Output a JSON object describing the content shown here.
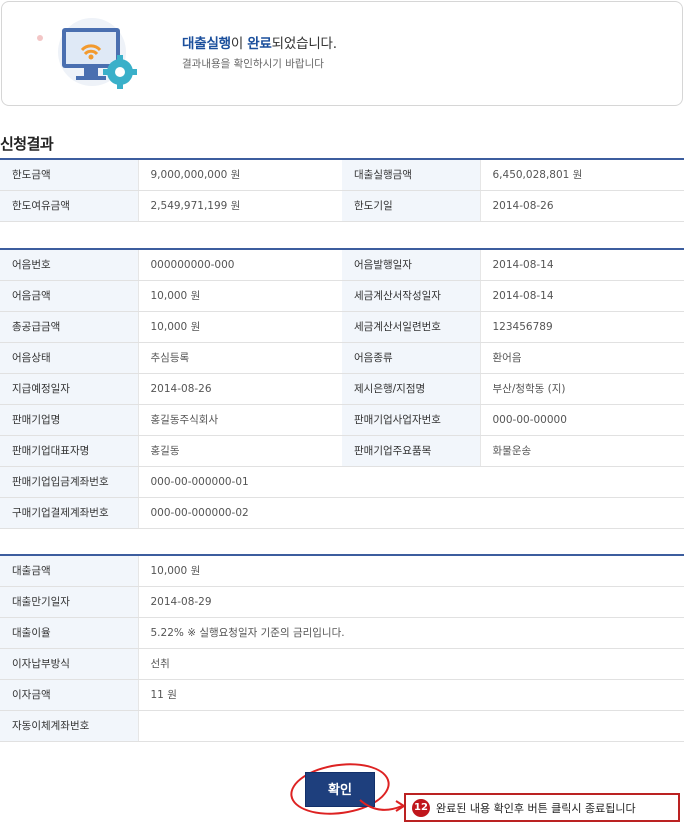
{
  "notice": {
    "msg_part1": "대출실행",
    "msg_part2": "이 ",
    "msg_part3": "완료",
    "msg_part4": "되었습니다.",
    "sub": "결과내용을 확인하시기 바랍니다"
  },
  "section_title": "신청결과",
  "summary": [
    [
      "한도금액",
      "9,000,000,000 원",
      "대출실행금액",
      "6,450,028,801 원"
    ],
    [
      "한도여유금액",
      "2,549,971,199 원",
      "한도기일",
      "2014-08-26"
    ]
  ],
  "bill": [
    [
      "어음번호",
      "000000000-000",
      "어음발행일자",
      "2014-08-14"
    ],
    [
      "어음금액",
      "10,000 원",
      "세금계산서작성일자",
      "2014-08-14"
    ],
    [
      "총공급금액",
      "10,000 원",
      "세금계산서일련번호",
      "123456789"
    ],
    [
      "어음상태",
      "추심등록",
      "어음종류",
      "환어음"
    ],
    [
      "지급예정일자",
      "2014-08-26",
      "제시은행/지점명",
      "부산/청학동 (지)"
    ],
    [
      "판매기업명",
      "홍길동주식회사",
      "판매기업사업자번호",
      "000-00-00000"
    ],
    [
      "판매기업대표자명",
      "홍길동",
      "판매기업주요품목",
      "화물운송"
    ]
  ],
  "bill_wide": [
    [
      "판매기업입금계좌번호",
      "000-00-000000-01"
    ],
    [
      "구매기업결제계좌번호",
      "000-00-000000-02"
    ]
  ],
  "loan": [
    [
      "대출금액",
      "10,000 원"
    ],
    [
      "대출만기일자",
      "2014-08-29"
    ],
    [
      "대출이율",
      "5.22% ※ 실행요청일자 기준의 금리입니다."
    ],
    [
      "이자납부방식",
      "선취"
    ],
    [
      "이자금액",
      "11 원"
    ],
    [
      "자동이체계좌번호",
      ""
    ]
  ],
  "confirm_button": "확인",
  "callout": {
    "step": "12",
    "text": "완료된 내용 확인후 버튼 클릭시 종료됩니다"
  },
  "colors": {
    "accent": "#1b4f9c",
    "table_border": "#3c5d9e",
    "button": "#1e3f7d",
    "highlight_red": "#c0161c"
  }
}
